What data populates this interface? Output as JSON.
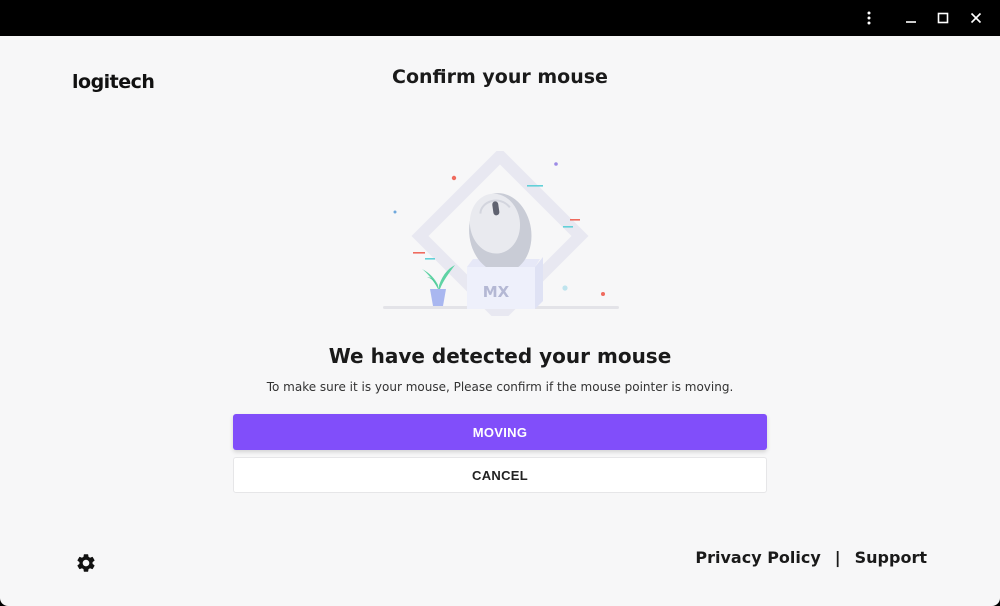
{
  "window": {
    "controls": {
      "menu_icon": "kebab-menu-icon",
      "minimize_icon": "minimize-icon",
      "maximize_icon": "maximize-icon",
      "close_icon": "close-icon"
    }
  },
  "header": {
    "logo_text": "logitech",
    "title": "Confirm your mouse"
  },
  "illustration": {
    "box_label": "MX",
    "icon": "mouse-in-box-illustration"
  },
  "main": {
    "heading": "We have detected your mouse",
    "description": "To make sure it is your mouse, Please confirm if the mouse pointer is moving.",
    "primary_button": "MOVING",
    "secondary_button": "CANCEL"
  },
  "footer": {
    "settings_icon": "gear-icon",
    "privacy_link": "Privacy Policy",
    "separator": "|",
    "support_link": "Support"
  },
  "colors": {
    "accent": "#814efa",
    "background": "#f7f7f8",
    "titlebar": "#000000"
  }
}
